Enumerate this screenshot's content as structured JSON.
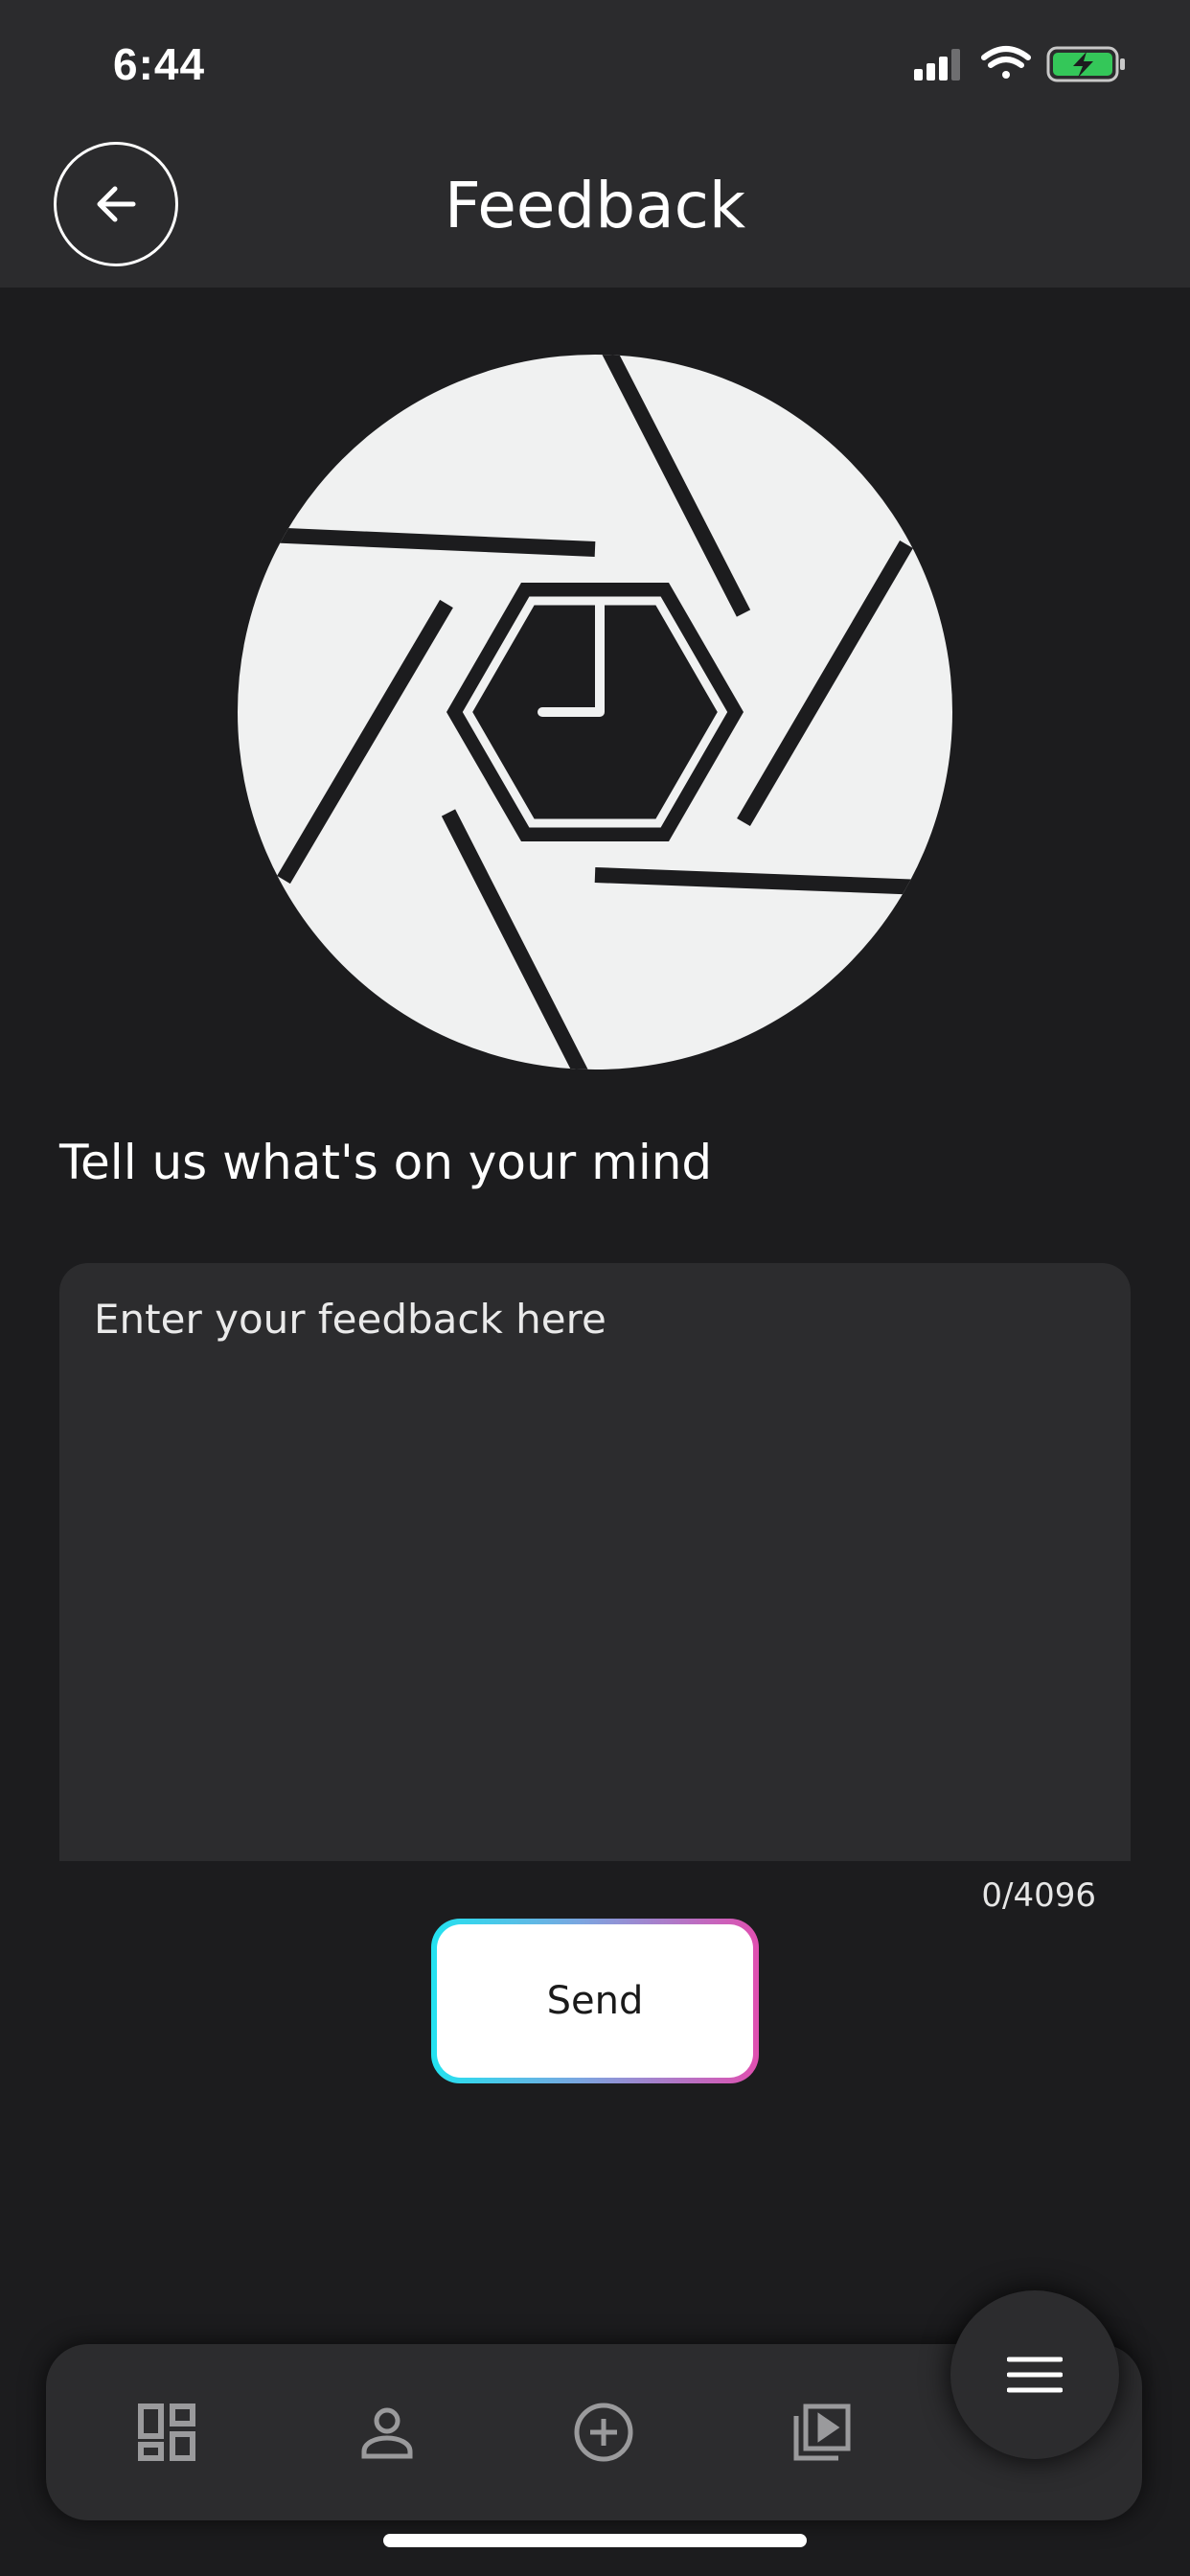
{
  "status_bar": {
    "time": "6:44",
    "icons": [
      "signal-icon",
      "wifi-icon",
      "battery-charging-icon"
    ],
    "battery_color": "#34c759"
  },
  "nav": {
    "title": "Feedback",
    "back_icon": "arrow-left-icon"
  },
  "logo": {
    "icon": "camera-aperture-clock-logo"
  },
  "form": {
    "prompt": "Tell us what's on your mind",
    "feedback_value": "",
    "feedback_placeholder": "Enter your feedback here",
    "char_count": "0/4096",
    "send_label": "Send",
    "send_gradient": [
      "#22e3f0",
      "#e04fb0"
    ]
  },
  "tab_bar": {
    "items": [
      {
        "name": "dashboard",
        "icon": "dashboard-icon"
      },
      {
        "name": "profile",
        "icon": "person-icon"
      },
      {
        "name": "add",
        "icon": "plus-circle-icon"
      },
      {
        "name": "media",
        "icon": "video-library-icon"
      }
    ],
    "menu_icon": "hamburger-menu-icon"
  },
  "colors": {
    "background": "#1c1c1e",
    "bar": "#2b2b2d",
    "card": "#2c2c2e",
    "icon_muted": "#9a9a9c"
  }
}
